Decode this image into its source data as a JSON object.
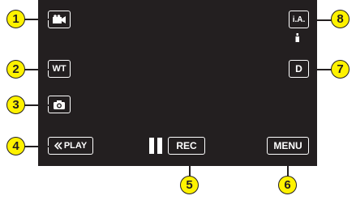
{
  "buttons": {
    "mode_icon": "movie-camera-icon",
    "wt": "WT",
    "snapshot_icon": "camera-icon",
    "play": "PLAY",
    "play_icon": "double-chevron-left-icon",
    "pause_icon": "pause-icon",
    "rec": "REC",
    "menu": "MENU",
    "ia": "i.A.",
    "d": "D"
  },
  "callouts": [
    "1",
    "2",
    "3",
    "4",
    "5",
    "6",
    "7",
    "8"
  ],
  "colors": {
    "screen": "#231f20",
    "callout": "#fff200",
    "button_text": "#ffffff"
  }
}
